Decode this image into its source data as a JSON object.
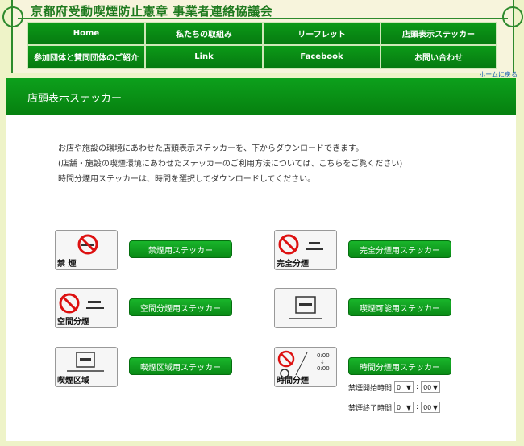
{
  "site": {
    "title": "京都府受動喫煙防止憲章 事業者連絡協議会"
  },
  "nav": {
    "row1": [
      "Home",
      "私たちの取組み",
      "リーフレット",
      "店頭表示ステッカー"
    ],
    "row2": [
      "参加団体と賛同団体のご紹介",
      "Link",
      "Facebook",
      "お問い合わせ"
    ]
  },
  "home_link": "ホームに戻る",
  "page": {
    "heading": "店頭表示ステッカー",
    "intro": [
      "お店や施設の環境にあわせた店頭表示ステッカーを、下からダウンロードできます。",
      "(店舗・施設の喫煙環境にあわせたステッカーのご利用方法については、こちらをご覧ください)",
      "時間分煙用ステッカーは、時間を選択してダウンロードしてください。"
    ]
  },
  "stickers": [
    {
      "thumb_label": "禁 煙",
      "button": "禁煙用ステッカー"
    },
    {
      "thumb_label": "完全分煙",
      "button": "完全分煙用ステッカー"
    },
    {
      "thumb_label": "空間分煙",
      "button": "空間分煙用ステッカー"
    },
    {
      "thumb_label": "",
      "button": "喫煙可能用ステッカー"
    },
    {
      "thumb_label": "喫煙区域",
      "button": "喫煙区域用ステッカー"
    },
    {
      "thumb_label": "時間分煙",
      "button": "時間分煙用ステッカー"
    }
  ],
  "time_select": {
    "start_label": "禁煙開始時間",
    "end_label": "禁煙終了時間",
    "start_hour": "0",
    "start_min": "00",
    "end_hour": "0",
    "end_min": "00",
    "colon": ":",
    "dropdown_arrow": "▼"
  },
  "colors": {
    "accent": "#0a9a18",
    "dark": "#066e10"
  }
}
